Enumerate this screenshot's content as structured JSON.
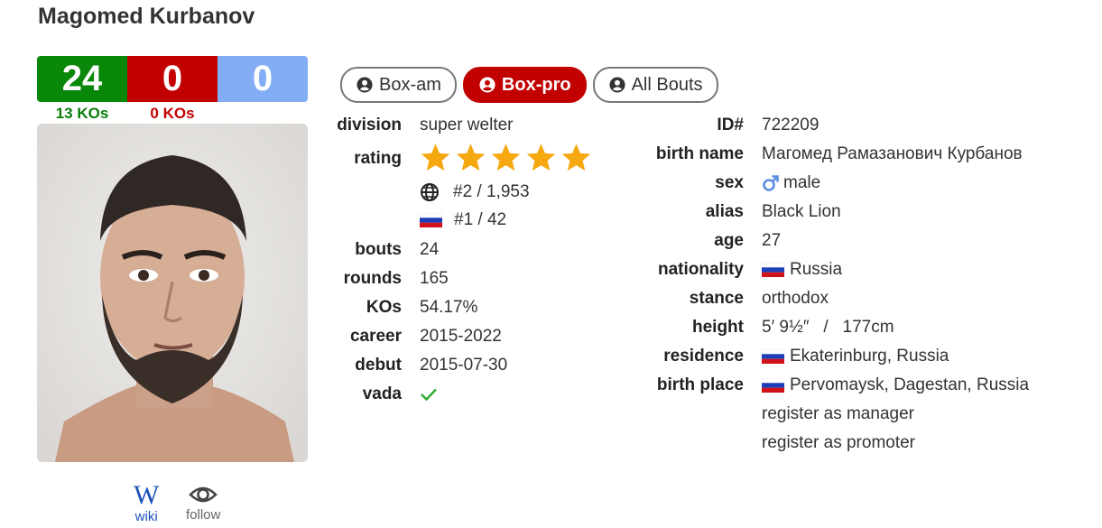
{
  "boxer": {
    "name": "Magomed Kurbanov"
  },
  "record": {
    "wins": "24",
    "losses": "0",
    "draws": "0",
    "win_kos": "13 KOs",
    "loss_kos": "0 KOs"
  },
  "tabs": [
    {
      "label": "Box-am",
      "active": false
    },
    {
      "label": "Box-pro",
      "active": true
    },
    {
      "label": "All Bouts",
      "active": false
    }
  ],
  "left": {
    "division": {
      "label": "division",
      "value": "super welter"
    },
    "rating": {
      "label": "rating",
      "stars": 5,
      "world_rank": "#2 / 1,953",
      "country_rank": "#1 / 42"
    },
    "bouts": {
      "label": "bouts",
      "value": "24"
    },
    "rounds": {
      "label": "rounds",
      "value": "165"
    },
    "kos": {
      "label": "KOs",
      "value": "54.17%"
    },
    "career": {
      "label": "career",
      "value": "2015-2022"
    },
    "debut": {
      "label": "debut",
      "value": "2015-07-30"
    },
    "vada": {
      "label": "vada",
      "icon": "check-icon"
    }
  },
  "right": {
    "id": {
      "label": "ID#",
      "value": "722209"
    },
    "birth_name": {
      "label": "birth name",
      "value": "Магомед Рамазанович Курбанов"
    },
    "sex": {
      "label": "sex",
      "value": "male",
      "icon": "male-icon"
    },
    "alias": {
      "label": "alias",
      "value": "Black Lion"
    },
    "age": {
      "label": "age",
      "value": "27"
    },
    "nationality": {
      "label": "nationality",
      "value": "Russia"
    },
    "stance": {
      "label": "stance",
      "value": "orthodox"
    },
    "height": {
      "label": "height",
      "value": "5′ 9½″   /   177cm"
    },
    "residence": {
      "label": "residence",
      "value": "Ekaterinburg, Russia"
    },
    "birth_place": {
      "label": "birth place",
      "value": "Pervomaysk, Dagestan, Russia"
    },
    "register_manager": "register as manager",
    "register_promoter": "register as promoter"
  },
  "links": {
    "wiki": "wiki",
    "follow": "follow"
  },
  "colors": {
    "win": "#088708",
    "loss": "#c20000",
    "draw": "#83aef5",
    "star": "#f6a811",
    "link_red": "#a00000"
  }
}
